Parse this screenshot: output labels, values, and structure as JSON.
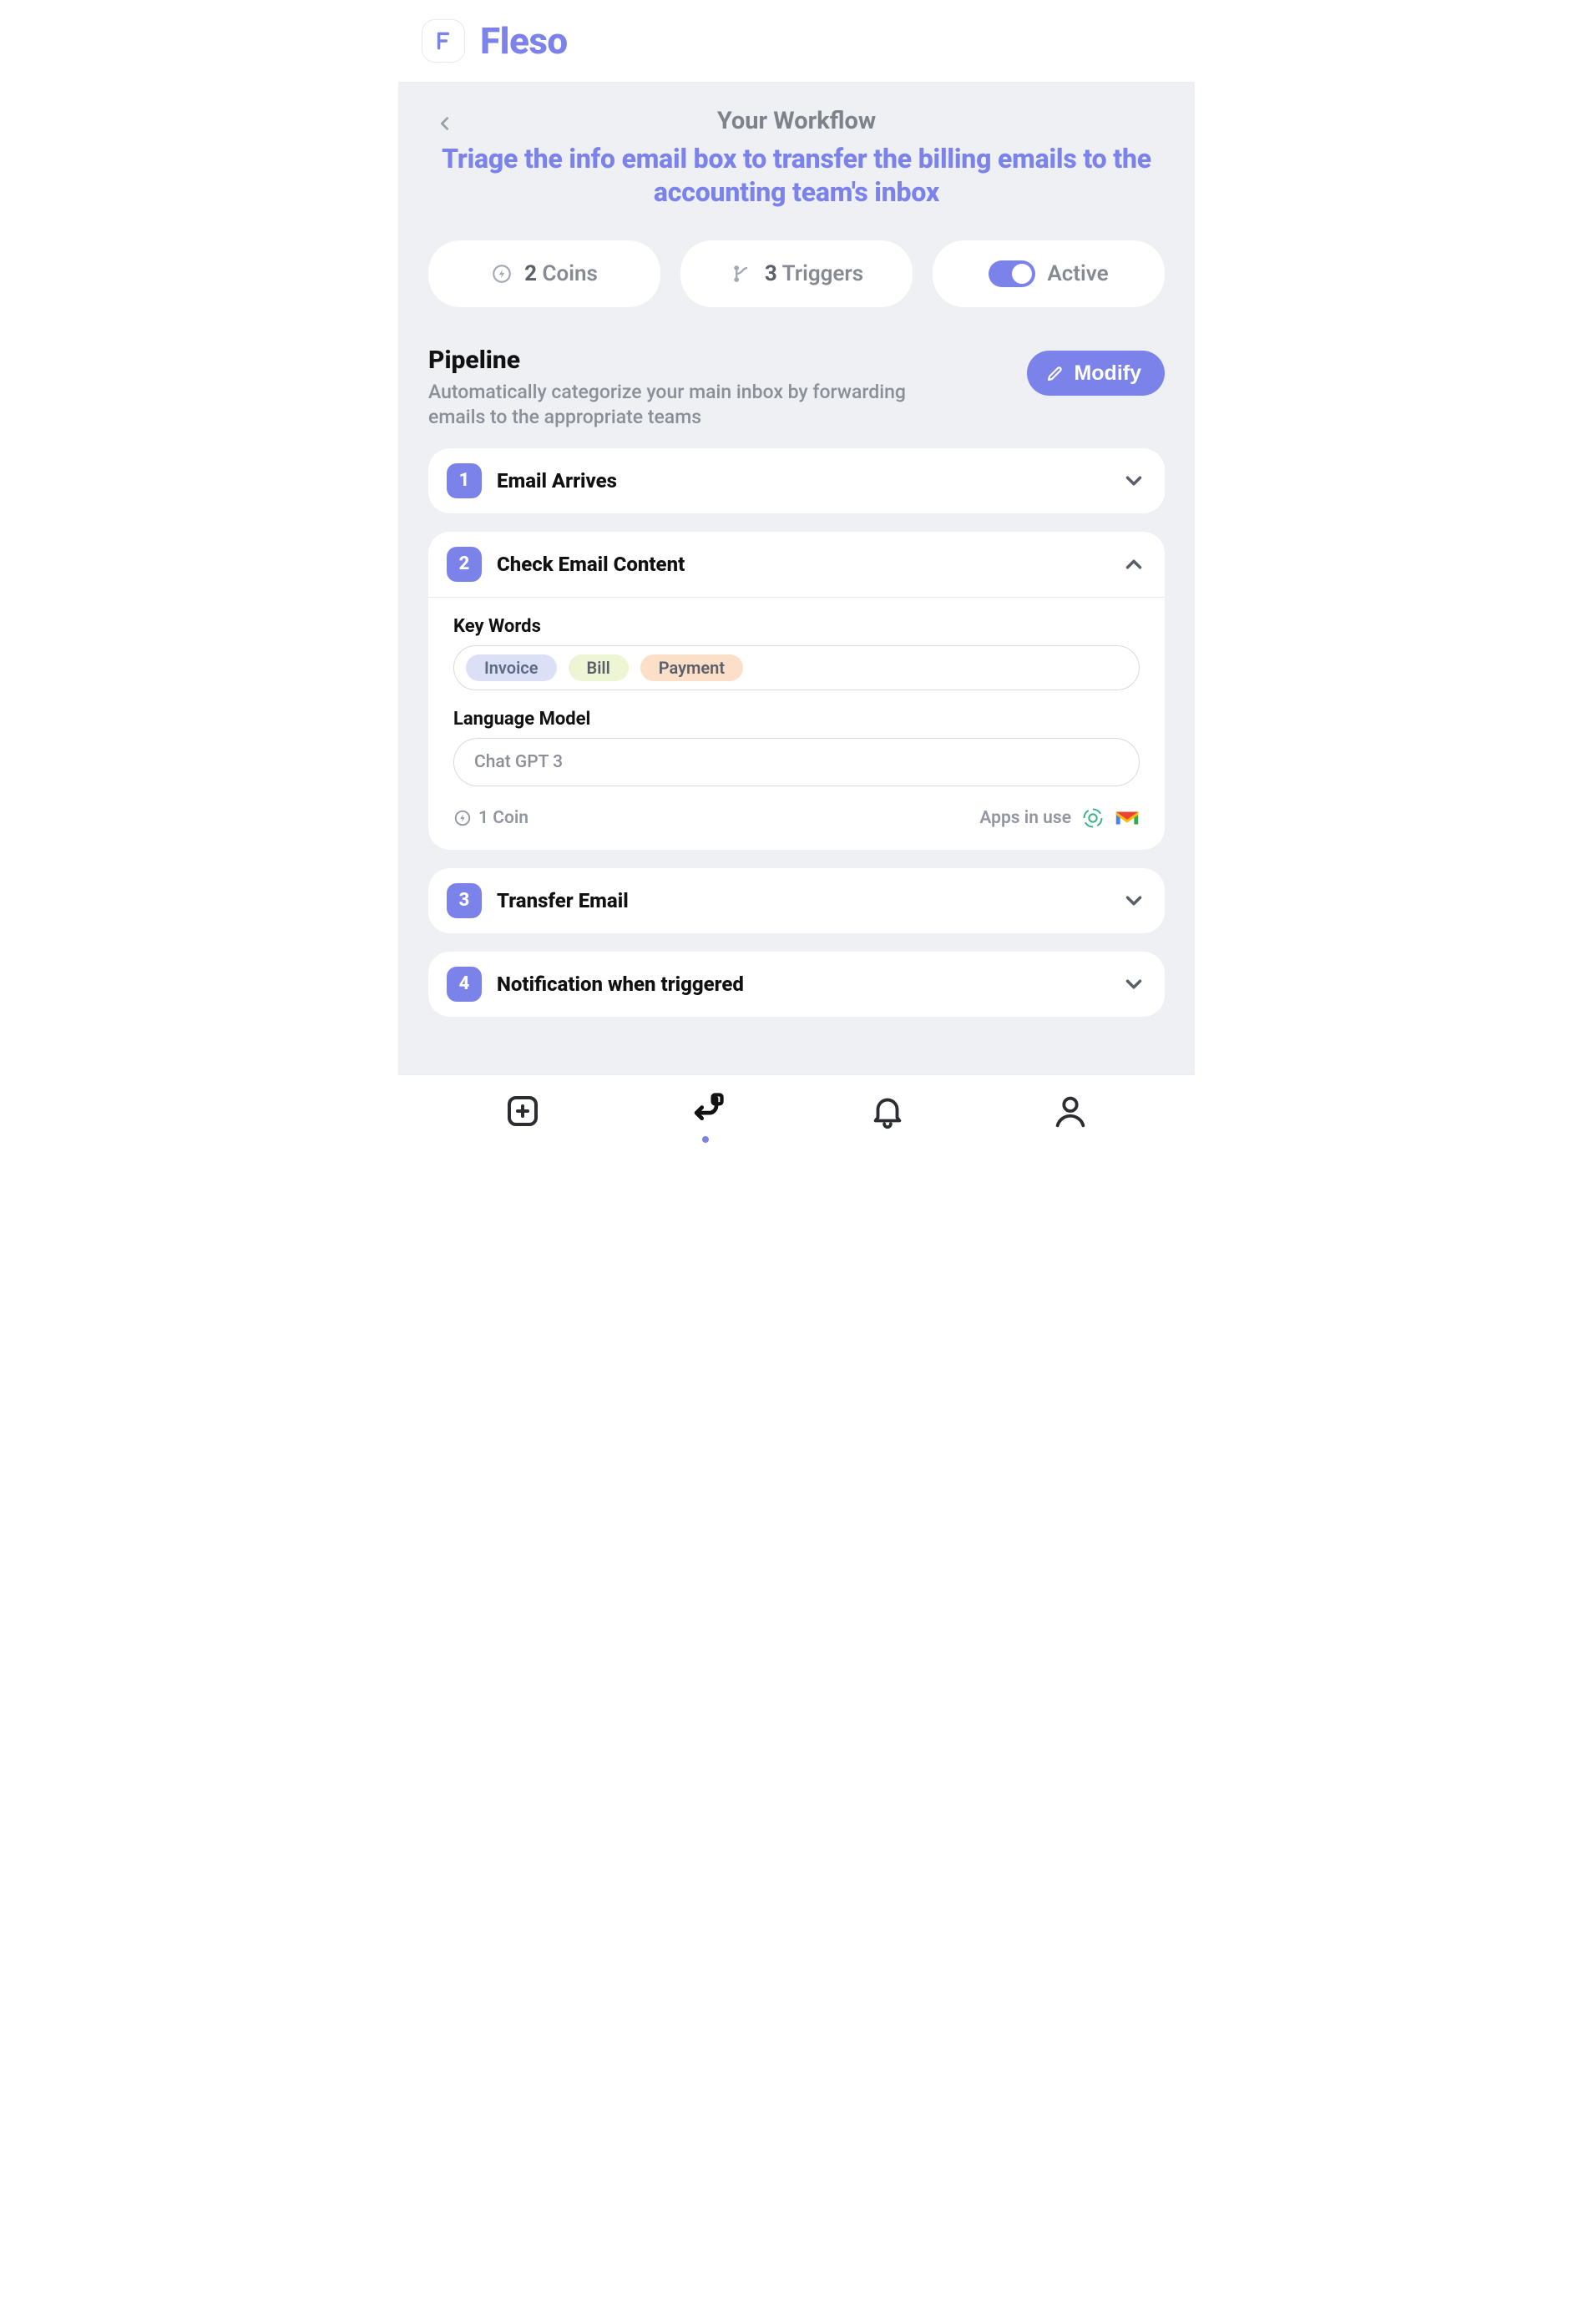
{
  "brand": "Fleso",
  "header": {
    "subtitle": "Your Workflow",
    "title": "Triage the info email box to transfer the billing emails to the accounting team's inbox"
  },
  "stats": {
    "coins": {
      "value": "2",
      "label": "Coins"
    },
    "triggers": {
      "value": "3",
      "label": "Triggers"
    },
    "active_label": "Active",
    "active": true
  },
  "pipeline": {
    "title": "Pipeline",
    "description": "Automatically categorize your main inbox by forwarding emails to the appropriate teams",
    "modify_label": "Modify"
  },
  "steps": [
    {
      "number": "1",
      "title": "Email Arrives",
      "expanded": false
    },
    {
      "number": "2",
      "title": "Check Email Content",
      "expanded": true,
      "keywords_label": "Key Words",
      "keywords": [
        {
          "text": "Invoice",
          "cls": "blue"
        },
        {
          "text": "Bill",
          "cls": "green"
        },
        {
          "text": "Payment",
          "cls": "orange"
        }
      ],
      "lm_label": "Language Model",
      "lm_value": "Chat GPT 3",
      "cost_label": "1 Coin",
      "apps_label": "Apps in use"
    },
    {
      "number": "3",
      "title": "Transfer Email",
      "expanded": false
    },
    {
      "number": "4",
      "title": "Notification when triggered",
      "expanded": false
    }
  ]
}
